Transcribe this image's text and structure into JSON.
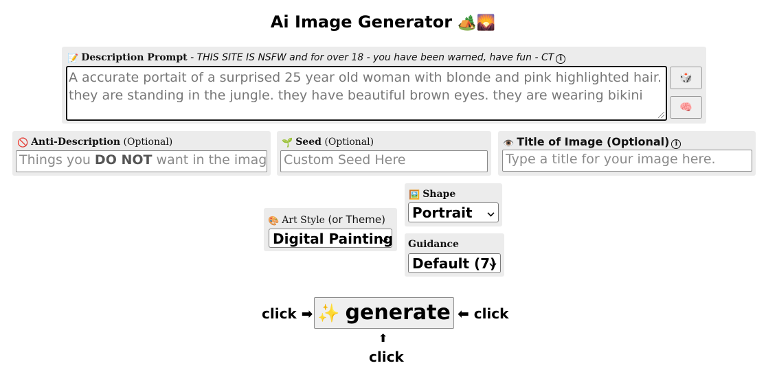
{
  "header": {
    "title": "Ai Image Generator",
    "title_emoji": "🏕️🌄"
  },
  "description": {
    "emoji": "📝",
    "label": "Description Prompt",
    "note": " - THIS SITE IS NSFW and for over 18 - you have been warned, have fun - CT",
    "info_icon": "info-icon",
    "value": "A accurate portait of a surprised 25 year old woman with blonde and pink highlighted hair. they are standing in the jungle. they have beautiful brown eyes. they are wearing bikini",
    "random_button_icon": "🎲",
    "idea_button_icon": "🧠"
  },
  "anti_description": {
    "emoji": "🚫",
    "label": "Anti-Description",
    "optional": "(Optional)",
    "placeholder_pre": "Things you ",
    "placeholder_bold": "DO NOT",
    "placeholder_post": " want in the image"
  },
  "seed": {
    "emoji": "🌱",
    "label": "Seed",
    "optional": "(Optional)",
    "placeholder": "Custom Seed Here"
  },
  "image_title": {
    "emoji": "👁️",
    "label": "Title of Image (Optional)",
    "info_icon": "info-icon",
    "placeholder": "Type a title for your image here."
  },
  "art_style": {
    "emoji": "🎨",
    "label": "Art Style",
    "label_suffix": "(or Theme)",
    "selected": "Digital Painting"
  },
  "shape": {
    "emoji": "🖼️",
    "label": "Shape",
    "selected": "Portrait"
  },
  "guidance": {
    "label": "Guidance",
    "selected": "Default (7)"
  },
  "generate": {
    "emoji": "✨",
    "label": "generate"
  },
  "hints": {
    "left": "click ➡",
    "right": "⬅ click",
    "below_arrow": "⬆",
    "below": "click"
  }
}
